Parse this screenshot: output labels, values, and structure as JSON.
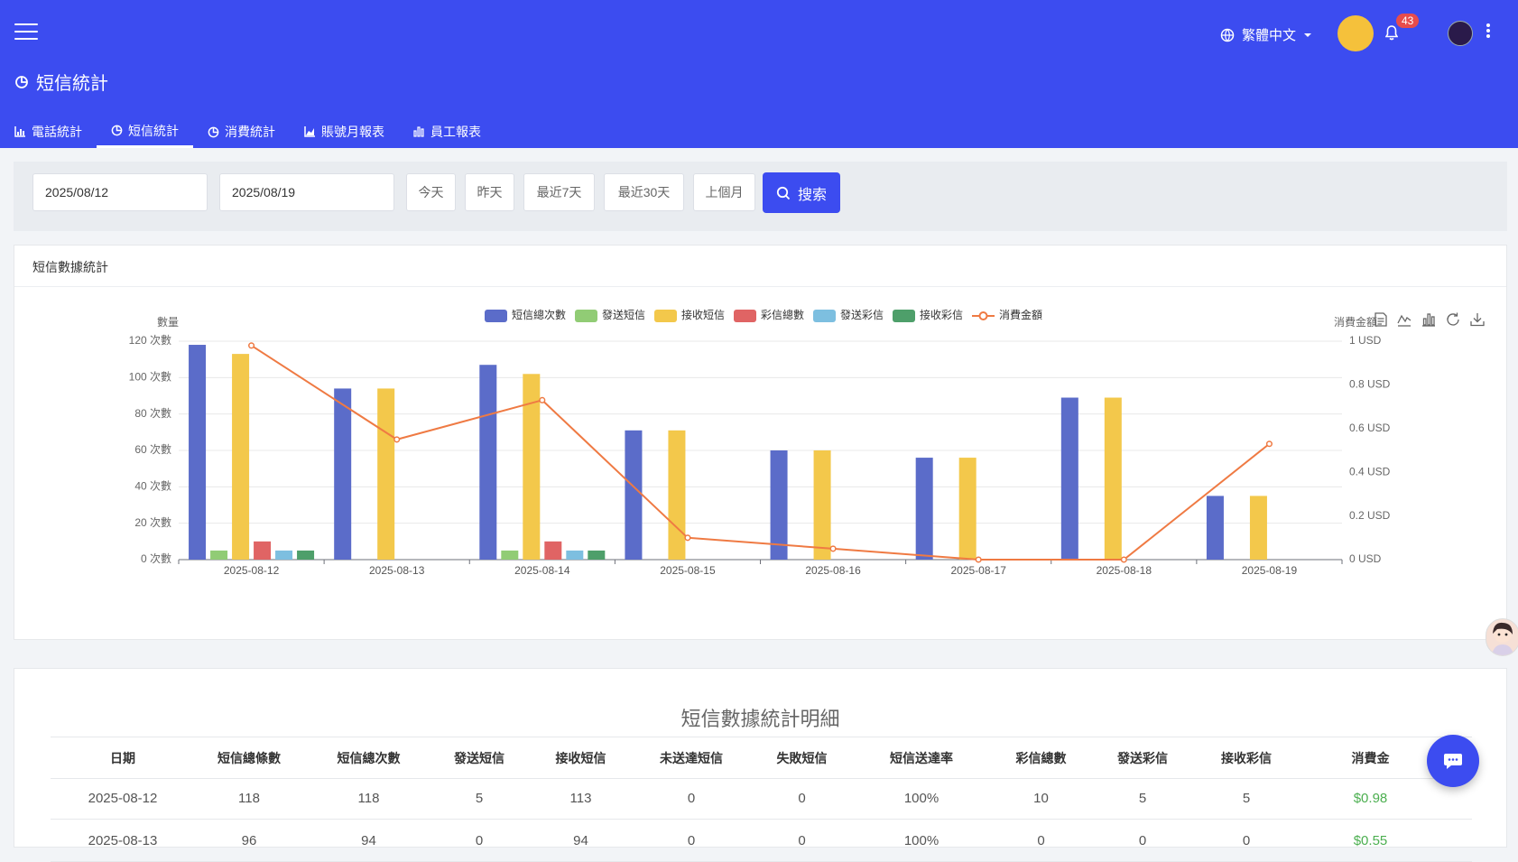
{
  "header": {
    "page_title": "短信統計",
    "language": "繁體中文",
    "notification_count": "43"
  },
  "tabs": [
    {
      "label": "電話統計",
      "icon": "bar-chart-icon"
    },
    {
      "label": "短信統計",
      "icon": "pie-chart-icon",
      "active": true
    },
    {
      "label": "消費統計",
      "icon": "pie-chart-icon"
    },
    {
      "label": "賬號月報表",
      "icon": "area-chart-icon"
    },
    {
      "label": "員工報表",
      "icon": "bar-chart-icon"
    }
  ],
  "filters": {
    "start_date": "2025/08/12",
    "end_date": "2025/08/19",
    "quick_buttons": [
      "今天",
      "昨天",
      "最近7天",
      "最近30天",
      "上個月"
    ],
    "search_label": "搜索"
  },
  "chart_card": {
    "title": "短信數據統計"
  },
  "chart_data": {
    "type": "bar",
    "categories": [
      "2025-08-12",
      "2025-08-13",
      "2025-08-14",
      "2025-08-15",
      "2025-08-16",
      "2025-08-17",
      "2025-08-18",
      "2025-08-19"
    ],
    "series": [
      {
        "name": "短信總次數",
        "type": "bar",
        "color": "#5b6cc9",
        "values": [
          118,
          94,
          107,
          71,
          60,
          56,
          89,
          35
        ]
      },
      {
        "name": "發送短信",
        "type": "bar",
        "color": "#91cc75",
        "values": [
          5,
          0,
          5,
          0,
          0,
          0,
          0,
          0
        ]
      },
      {
        "name": "接收短信",
        "type": "bar",
        "color": "#f3c84b",
        "values": [
          113,
          94,
          102,
          71,
          60,
          56,
          89,
          35
        ]
      },
      {
        "name": "彩信總數",
        "type": "bar",
        "color": "#e06464",
        "values": [
          10,
          0,
          10,
          0,
          0,
          0,
          0,
          0
        ]
      },
      {
        "name": "發送彩信",
        "type": "bar",
        "color": "#7dbfe0",
        "values": [
          5,
          0,
          5,
          0,
          0,
          0,
          0,
          0
        ]
      },
      {
        "name": "接收彩信",
        "type": "bar",
        "color": "#4e9f6a",
        "values": [
          5,
          0,
          5,
          0,
          0,
          0,
          0,
          0
        ]
      },
      {
        "name": "消費金額",
        "type": "line",
        "axis": "right",
        "color": "#ef7a43",
        "values": [
          0.98,
          0.55,
          0.73,
          0.1,
          0.05,
          0.0,
          0.0,
          0.53
        ]
      }
    ],
    "y_left": {
      "label": "數量",
      "min": 0,
      "max": 120,
      "ticks": [
        "0 次數",
        "20 次數",
        "40 次數",
        "60 次數",
        "80 次數",
        "100 次數",
        "120 次數"
      ]
    },
    "y_right": {
      "label": "消費金額",
      "min": 0,
      "max": 1,
      "ticks": [
        "0 USD",
        "0.2 USD",
        "0.4 USD",
        "0.6 USD",
        "0.8 USD",
        "1 USD"
      ]
    },
    "legend_position": "top-center",
    "grid": true
  },
  "toolbox_icons": [
    "data-view-icon",
    "line-chart-icon",
    "bar-chart-icon",
    "restore-icon",
    "download-icon"
  ],
  "table": {
    "title": "短信數據統計明細",
    "columns": [
      "日期",
      "短信總條數",
      "短信總次數",
      "發送短信",
      "接收短信",
      "未送達短信",
      "失敗短信",
      "短信送達率",
      "彩信總數",
      "發送彩信",
      "接收彩信",
      "消費金"
    ],
    "rows": [
      [
        "2025-08-12",
        "118",
        "118",
        "5",
        "113",
        "0",
        "0",
        "100%",
        "10",
        "5",
        "5",
        "$0.98"
      ],
      [
        "2025-08-13",
        "96",
        "94",
        "0",
        "94",
        "0",
        "0",
        "100%",
        "0",
        "0",
        "0",
        "$0.55"
      ]
    ]
  },
  "colors": {
    "header_bg": "#3c4cf0",
    "accent": "#3c4cf0",
    "money": "#4caf50",
    "badge": "#e84c4c"
  }
}
